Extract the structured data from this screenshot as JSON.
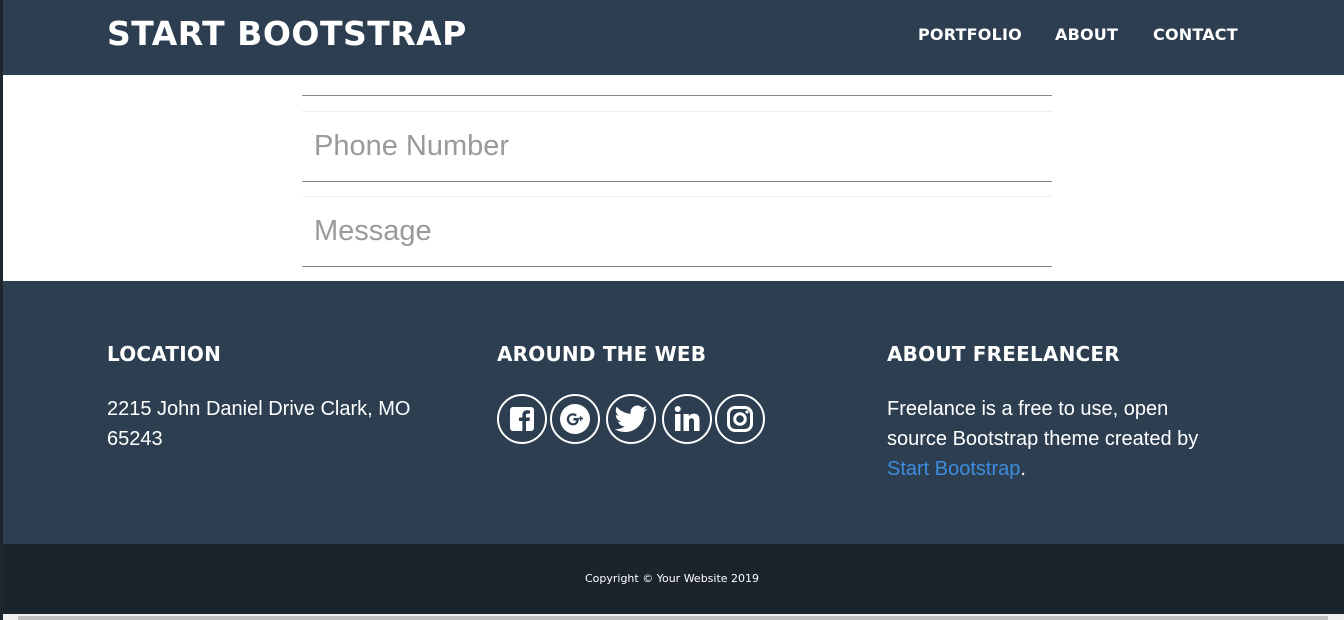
{
  "navbar": {
    "brand": "START BOOTSTRAP",
    "items": [
      {
        "label": "PORTFOLIO"
      },
      {
        "label": "ABOUT"
      },
      {
        "label": "CONTACT"
      }
    ]
  },
  "form": {
    "phone_placeholder": "Phone Number",
    "message_placeholder": "Message"
  },
  "footer": {
    "location": {
      "title": "LOCATION",
      "line1": "2215 John Daniel Drive Clark, MO",
      "line2": "65243"
    },
    "web": {
      "title": "AROUND THE WEB",
      "icons": [
        "facebook-icon",
        "google-plus-icon",
        "twitter-icon",
        "linkedin-icon",
        "instagram-icon"
      ]
    },
    "about": {
      "title": "ABOUT FREELANCER",
      "line1": "Freelance is a free to use, open",
      "line2": "source Bootstrap theme created by",
      "link": "Start Bootstrap",
      "end": "."
    }
  },
  "copyright": "Copyright © Your Website 2019",
  "colors": {
    "primary": "#2c3e50",
    "dark": "#1b242d",
    "link": "#3d8ee0"
  }
}
